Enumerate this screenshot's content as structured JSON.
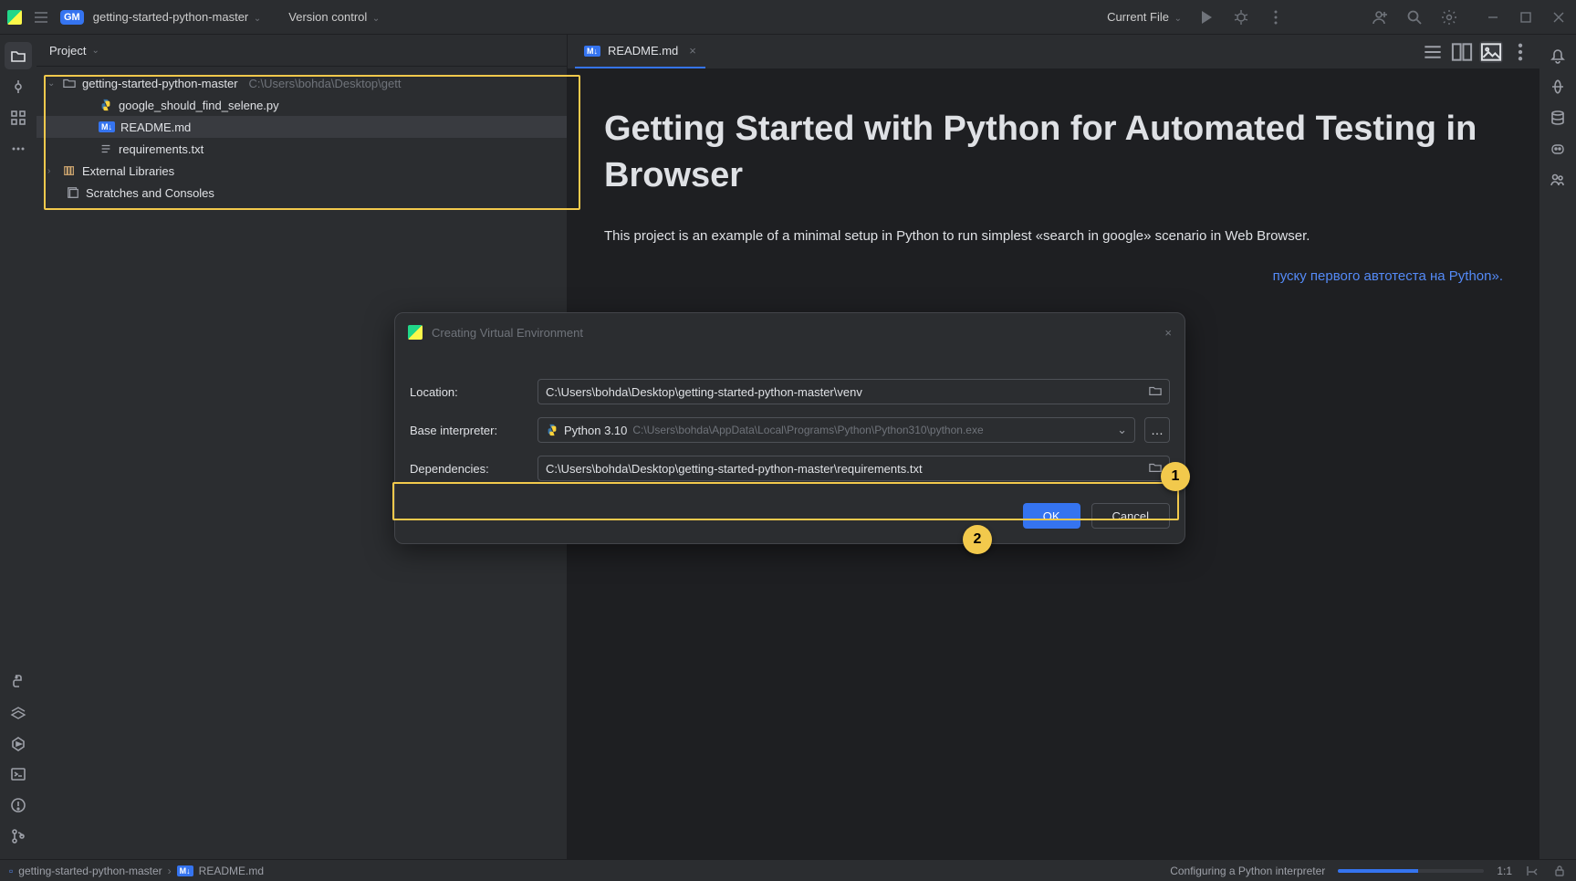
{
  "titlebar": {
    "project_badge": "GM",
    "project_name": "getting-started-python-master",
    "vc_label": "Version control",
    "current_file": "Current File"
  },
  "project_panel": {
    "header": "Project",
    "root_name": "getting-started-python-master",
    "root_path": "C:\\Users\\bohda\\Desktop\\gett",
    "files": [
      "google_should_find_selene.py",
      "README.md",
      "requirements.txt"
    ],
    "ext_libs": "External Libraries",
    "scratches": "Scratches and Consoles"
  },
  "tabs": {
    "readme": "README.md"
  },
  "editor": {
    "h1": "Getting Started with Python for Automated Testing in Browser",
    "p1": "This project is an example of a minimal setup in Python to run simplest «search in google» scenario in Web Browser.",
    "link_fragment": "пуску первого автотеста на Python»."
  },
  "dialog": {
    "title": "Creating Virtual Environment",
    "location_label": "Location:",
    "location_value": "C:\\Users\\bohda\\Desktop\\getting-started-python-master\\venv",
    "interp_label": "Base interpreter:",
    "interp_name": "Python 3.10",
    "interp_path": "C:\\Users\\bohda\\AppData\\Local\\Programs\\Python\\Python310\\python.exe",
    "deps_label": "Dependencies:",
    "deps_value": "C:\\Users\\bohda\\Desktop\\getting-started-python-master\\requirements.txt",
    "ok": "OK",
    "cancel": "Cancel"
  },
  "callouts": {
    "c1": "1",
    "c2": "2"
  },
  "status": {
    "crumb_project": "getting-started-python-master",
    "crumb_file": "README.md",
    "configuring": "Configuring a Python interpreter",
    "line_col": "1:1"
  }
}
